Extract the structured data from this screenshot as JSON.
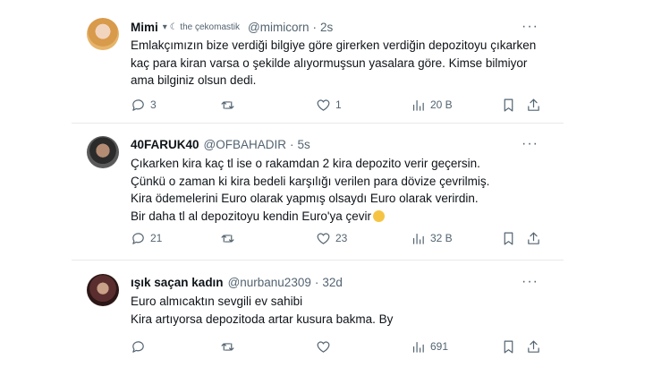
{
  "tweets": [
    {
      "name": "Mimi",
      "badge": "▾ ☾ the çekomastik",
      "handle": "@mimicorn",
      "time": "2s",
      "lines": [
        "Emlakçımızın bize verdiği bilgiye göre girerken verdiğin depozitoyu çıkarken",
        "kaç para kiran varsa o şekilde alıyormuşsun yasalara göre. Kimse bilmiyor",
        "ama bilginiz olsun dedi."
      ],
      "replies": "3",
      "retweets": "",
      "likes": "1",
      "views": "20 B"
    },
    {
      "name": "40FARUK40",
      "badge": "",
      "handle": "@OFBAHADIR",
      "time": "5s",
      "lines": [
        "Çıkarken kira kaç tl ise o rakamdan 2 kira depozito verir geçersin.",
        "Çünkü o zaman ki kira bedeli karşılığı verilen para dövize çevrilmiş.",
        "Kira ödemelerini Euro olarak yapmış olsaydı Euro olarak verirdin.",
        "Bir daha tl al depozitoyu kendin Euro'ya çevir"
      ],
      "replies": "21",
      "retweets": "",
      "likes": "23",
      "views": "32 B"
    },
    {
      "name": "ışık saçan kadın",
      "badge": "",
      "handle": "@nurbanu2309",
      "time": "32d",
      "lines": [
        "Euro almıcaktın sevgili ev sahibi",
        "Kira artıyorsa depozitoda artar kusura bakma. By"
      ],
      "replies": "",
      "retweets": "",
      "likes": "",
      "views": "691"
    }
  ],
  "icons": {
    "reply": "reply-icon",
    "retweet": "retweet-icon",
    "like": "heart-icon",
    "views": "views-icon",
    "bookmark": "bookmark-icon",
    "share": "share-icon",
    "more": "more-icon",
    "emoji": "relieved-face-emoji"
  },
  "colors": {
    "text": "#0f1419",
    "secondary": "#536471",
    "divider": "#e7e9ea"
  }
}
